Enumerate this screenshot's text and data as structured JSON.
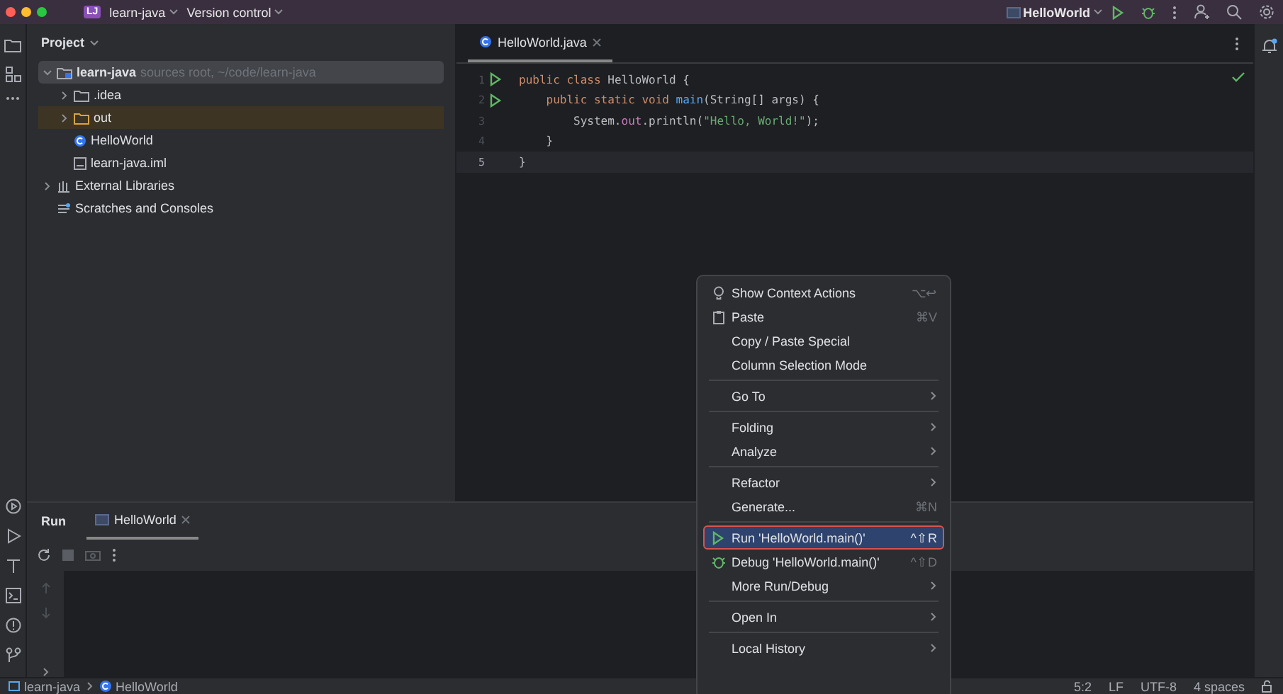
{
  "title_bar": {
    "project": {
      "badge": "LJ",
      "name": "learn-java"
    },
    "vcs": "Version control",
    "run_config": "HelloWorld"
  },
  "project_panel": {
    "title": "Project",
    "tree": [
      {
        "label": "learn-java",
        "hint": "sources root, ~/code/learn-java",
        "kind": "module",
        "expanded": true,
        "selected": true,
        "children": [
          {
            "label": ".idea",
            "kind": "folder",
            "expanded": false,
            "selected": false
          },
          {
            "label": "out",
            "kind": "excluded",
            "expanded": false,
            "selected": false
          },
          {
            "label": "HelloWorld",
            "kind": "class",
            "selected": false
          },
          {
            "label": "learn-java.iml",
            "kind": "file",
            "selected": false
          }
        ]
      },
      {
        "label": "External Libraries",
        "kind": "library",
        "expanded": false,
        "selected": false
      },
      {
        "label": "Scratches and Consoles",
        "kind": "scratch",
        "selected": false
      }
    ]
  },
  "editor": {
    "tabs": [
      {
        "label": "HelloWorld.java",
        "selected": true
      }
    ],
    "lines": [
      {
        "number": "1",
        "runnable": true,
        "tokens": [
          {
            "kind": "keyword",
            "text": "public class "
          },
          {
            "kind": "plain",
            "text": "HelloWorld "
          },
          {
            "kind": "brace",
            "text": "{"
          }
        ]
      },
      {
        "number": "2",
        "runnable": true,
        "tokens": [
          {
            "kind": "keyword",
            "text": "    public static void "
          },
          {
            "kind": "method",
            "text": "main"
          },
          {
            "kind": "plain",
            "text": "(String[] args) {"
          }
        ]
      },
      {
        "number": "3",
        "runnable": false,
        "tokens": [
          {
            "kind": "plain",
            "text": "        System."
          },
          {
            "kind": "field",
            "text": "out"
          },
          {
            "kind": "plain",
            "text": ".println("
          },
          {
            "kind": "string",
            "text": "\"Hello, World!\""
          },
          {
            "kind": "plain",
            "text": ");"
          }
        ]
      },
      {
        "number": "4",
        "runnable": false,
        "tokens": [
          {
            "kind": "plain",
            "text": "    }"
          }
        ]
      },
      {
        "number": "5",
        "runnable": false,
        "current": true,
        "tokens": [
          {
            "kind": "brace",
            "text": "}"
          }
        ]
      }
    ]
  },
  "context_menu": [
    {
      "kind": "intention",
      "label": "Show Context Actions",
      "shortcut": "⌥↩",
      "selected": false
    },
    {
      "kind": "paste",
      "label": "Paste",
      "shortcut": "⌘V",
      "selected": false
    },
    {
      "kind": "item",
      "label": "Copy / Paste Special",
      "selected": false
    },
    {
      "kind": "item",
      "label": "Column Selection Mode",
      "selected": false
    },
    {
      "kind": "separator"
    },
    {
      "kind": "item",
      "label": "Go To",
      "submenu": true,
      "selected": false
    },
    {
      "kind": "separator"
    },
    {
      "kind": "item",
      "label": "Folding",
      "submenu": true,
      "selected": false
    },
    {
      "kind": "item",
      "label": "Analyze",
      "submenu": true,
      "selected": false
    },
    {
      "kind": "separator"
    },
    {
      "kind": "item",
      "label": "Refactor",
      "submenu": true,
      "selected": false
    },
    {
      "kind": "item",
      "label": "Generate...",
      "shortcut": "⌘N",
      "selected": false
    },
    {
      "kind": "separator"
    },
    {
      "kind": "run",
      "label": "Run 'HelloWorld.main()'",
      "shortcut": "^⇧R",
      "selected": true
    },
    {
      "kind": "debug",
      "label": "Debug 'HelloWorld.main()'",
      "shortcut": "^⇧D",
      "selected": false
    },
    {
      "kind": "item",
      "label": "More Run/Debug",
      "submenu": true,
      "selected": false
    },
    {
      "kind": "separator"
    },
    {
      "kind": "item",
      "label": "Open In",
      "submenu": true,
      "selected": false
    },
    {
      "kind": "separator"
    },
    {
      "kind": "item",
      "label": "Local History",
      "submenu": true,
      "selected": false
    }
  ],
  "run_panel": {
    "title": "Run",
    "tabs": [
      {
        "label": "HelloWorld",
        "selected": true
      }
    ]
  },
  "status_bar": {
    "breadcrumbs": [
      "learn-java",
      "HelloWorld"
    ],
    "position": "5:2",
    "line_ending": "LF",
    "encoding": "UTF-8",
    "indent": "4 spaces"
  }
}
